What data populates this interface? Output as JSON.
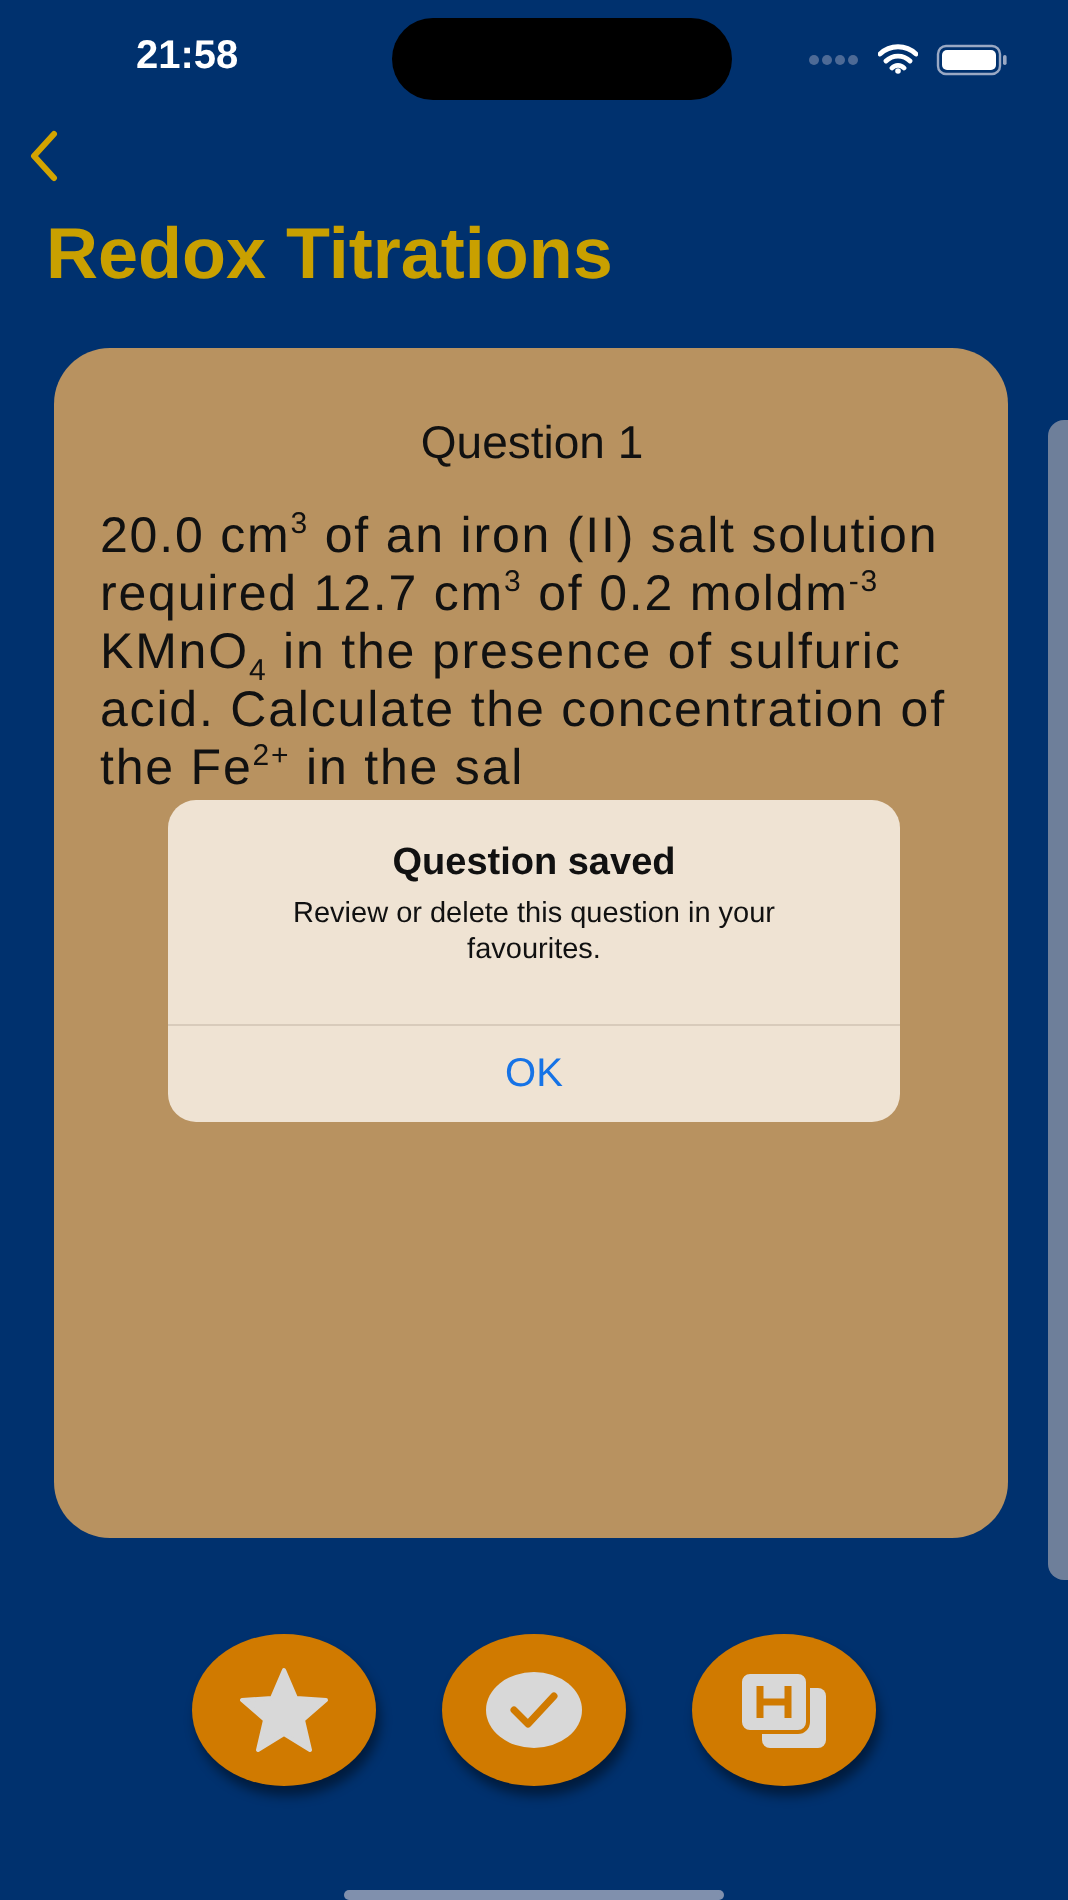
{
  "status_bar": {
    "time": "21:58"
  },
  "nav": {
    "title": "Redox Titrations"
  },
  "card": {
    "heading": "Question 1",
    "text": "20.0 cm$^{3}$ of an iron (II) salt solution required 12.7 cm$^{3}$ of 0.2 moldm$^{-3}$ KMnO$_{4}$ in the presence of sulfuric acid. Calculate the concentration of the Fe$^{2+}$ in the sal"
  },
  "alert": {
    "title": "Question saved",
    "message": "Review or delete this question in your favourites.",
    "buttons": [
      "OK"
    ]
  },
  "actions": [
    {
      "kind": "star"
    },
    {
      "kind": "check"
    },
    {
      "kind": "hint"
    }
  ]
}
